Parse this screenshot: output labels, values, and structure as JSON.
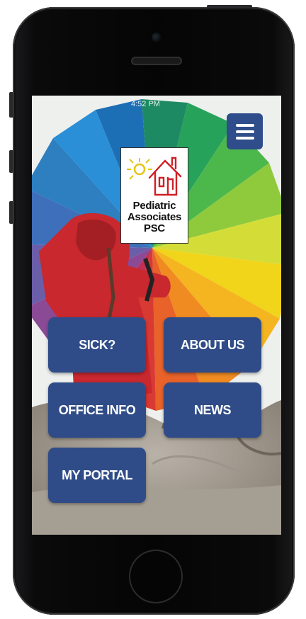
{
  "status": {
    "time": "4:52 PM"
  },
  "logo": {
    "line1": "Pediatric",
    "line2": "Associates",
    "line3": "PSC"
  },
  "tiles": {
    "sick": "SICK?",
    "about": "ABOUT US",
    "office": "OFFICE INFO",
    "news": "NEWS",
    "portal": "MY PORTAL"
  },
  "colors": {
    "tile": "#2f4c88",
    "menu": "#2e4d8a"
  },
  "icons": {
    "menu": "hamburger-menu-icon"
  }
}
